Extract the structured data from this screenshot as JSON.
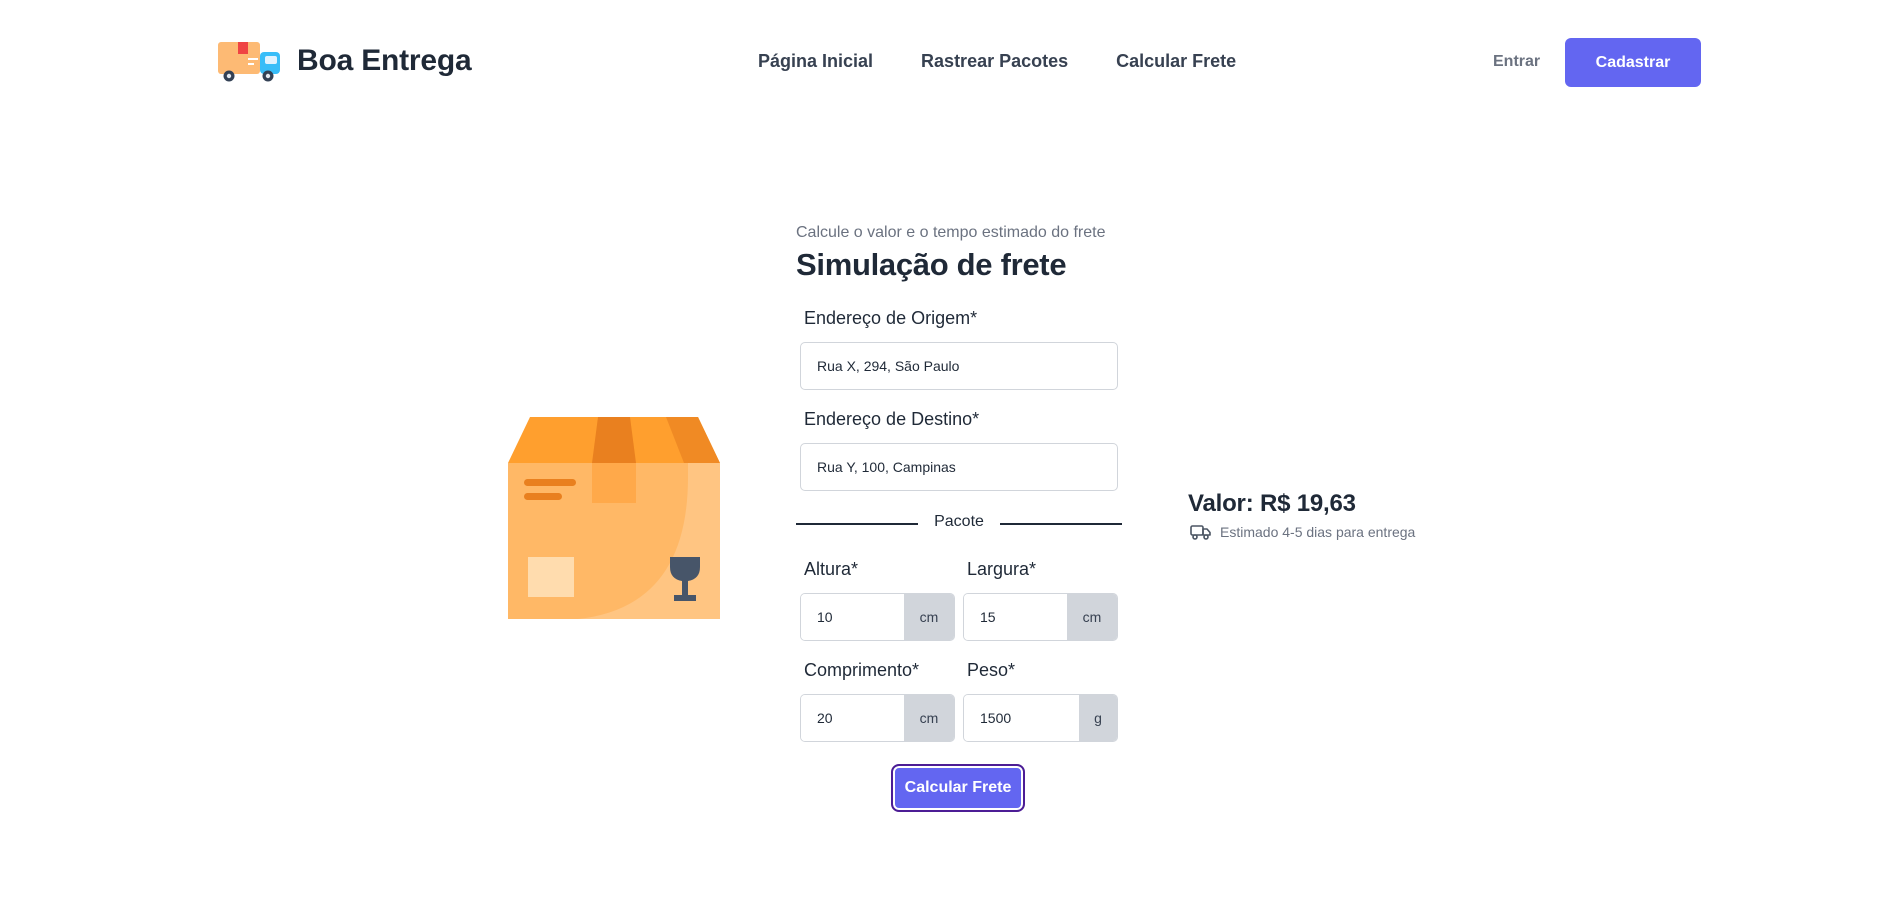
{
  "header": {
    "brand": "Boa Entrega",
    "nav": [
      {
        "label": "Página Inicial"
      },
      {
        "label": "Rastrear Pacotes"
      },
      {
        "label": "Calcular Frete"
      }
    ],
    "login_label": "Entrar",
    "signup_label": "Cadastrar",
    "logo_icon": "delivery-truck-icon"
  },
  "form": {
    "subtitle": "Calcule o valor e o tempo estimado do frete",
    "title": "Simulação de frete",
    "origin": {
      "label": "Endereço de Origem*",
      "value": "Rua X, 294, São Paulo"
    },
    "destination": {
      "label": "Endereço de Destino*",
      "value": "Rua Y, 100, Campinas"
    },
    "package_divider": "Pacote",
    "height": {
      "label": "Altura*",
      "value": "10",
      "unit": "cm"
    },
    "width": {
      "label": "Largura*",
      "value": "15",
      "unit": "cm"
    },
    "length": {
      "label": "Comprimento*",
      "value": "20",
      "unit": "cm"
    },
    "weight": {
      "label": "Peso*",
      "value": "1500",
      "unit": "g"
    },
    "submit_label": "Calcular Frete"
  },
  "result": {
    "value": "Valor: R$ 19,63",
    "estimate": "Estimado 4-5 dias para entrega",
    "icon": "truck-icon"
  },
  "illustration": {
    "icon": "cardboard-box-icon"
  },
  "colors": {
    "accent": "#6366f1",
    "box": "#ffa733",
    "text": "#1f2937"
  }
}
